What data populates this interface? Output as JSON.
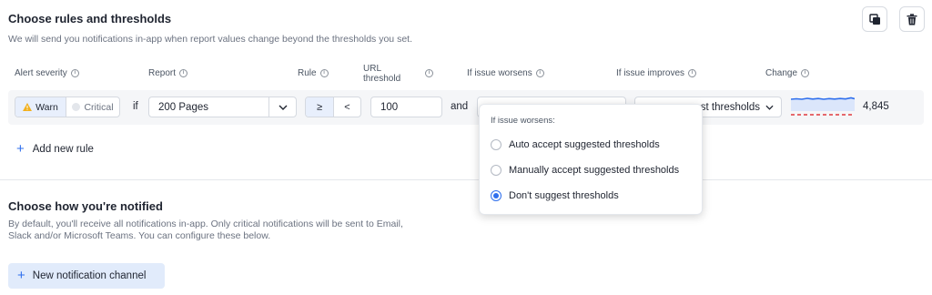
{
  "rules_section": {
    "title": "Choose rules and thresholds",
    "description": "We will send you notifications in-app when report values change beyond the thresholds you set.",
    "copy_icon": "copy-icon",
    "delete_icon": "trash-icon"
  },
  "columns": {
    "alert_severity": "Alert severity",
    "report": "Report",
    "rule": "Rule",
    "url_threshold_line1": "URL",
    "url_threshold_line2": "threshold",
    "if_worsens": "If issue worsens",
    "if_improves": "If issue improves",
    "change": "Change"
  },
  "rule_row": {
    "severity_warn": "Warn",
    "severity_critical": "Critical",
    "if_label": "if",
    "report_value": "200 Pages",
    "rule_gte": "≥",
    "rule_lt": "<",
    "threshold_value": "100",
    "and_label": "and",
    "improves_value": "st thresholds",
    "change_value": "4,845"
  },
  "dropdown": {
    "heading": "If issue worsens:",
    "options": [
      {
        "label": "Auto accept suggested thresholds",
        "selected": false
      },
      {
        "label": "Manually accept suggested thresholds",
        "selected": false
      },
      {
        "label": "Don't suggest thresholds",
        "selected": true
      }
    ]
  },
  "add_rule_label": "Add new rule",
  "notify_section": {
    "title": "Choose how you're notified",
    "description_line1": "By default, you'll receive all notifications in-app. Only critical notifications will be sent to Email,",
    "description_line2": "Slack and/or Microsoft Teams. You can configure these below.",
    "new_channel_label": "New notification channel"
  },
  "colors": {
    "accent": "#2f6fed",
    "warn_bg": "#e8effc",
    "warn_icon": "#f2b01e",
    "sparkline": "#2f6fed",
    "threshold_line": "#e0393e"
  }
}
